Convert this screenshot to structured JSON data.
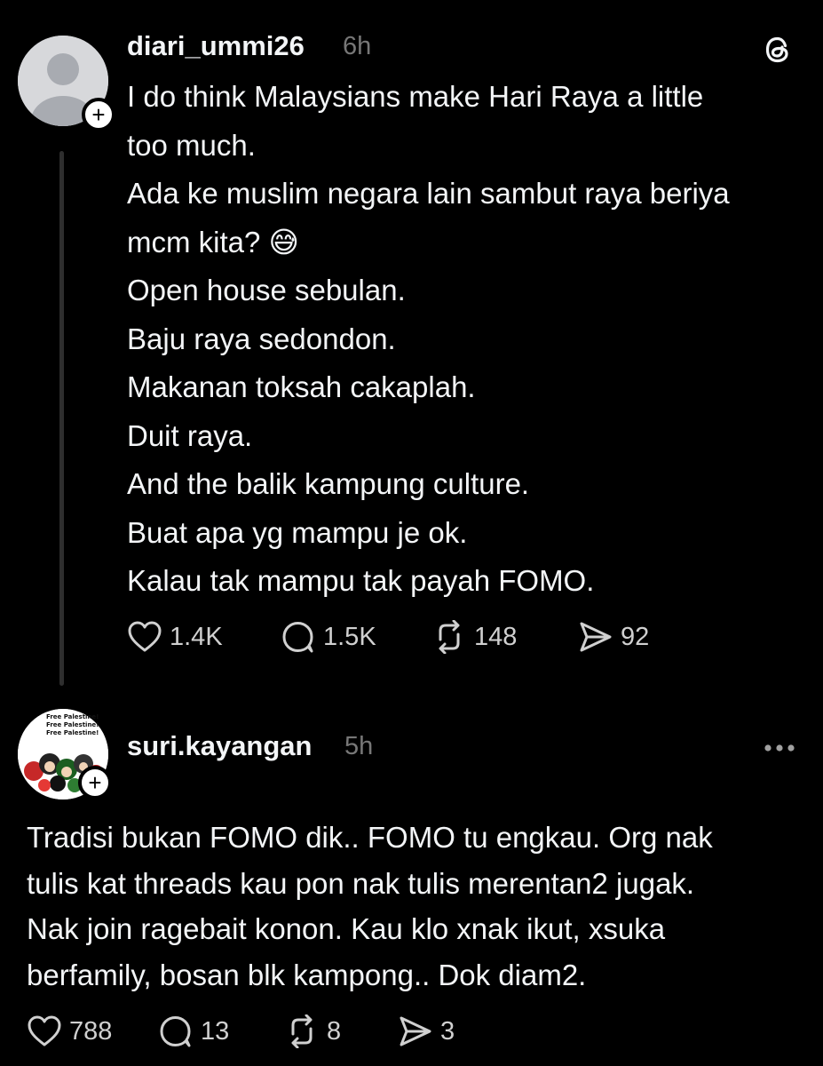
{
  "posts": [
    {
      "username": "diari_ummi26",
      "time": "6h",
      "body_lines": [
        "I do think Malaysians make Hari Raya a little",
        "too much.",
        "Ada ke muslim negara lain sambut raya beriya",
        "mcm kita? 😅",
        "Open house sebulan.",
        "Baju raya sedondon.",
        "Makanan toksah cakaplah.",
        "Duit raya.",
        "And the balik kampung culture.",
        "Buat apa yg mampu je ok.",
        "Kalau tak mampu tak payah FOMO."
      ],
      "likes": "1.4K",
      "replies": "1.5K",
      "reposts": "148",
      "shares": "92",
      "follow_glyph": "+",
      "top_right_icon": "threads-logo-icon"
    },
    {
      "username": "suri.kayangan",
      "time": "5h",
      "avatar_text": [
        "Free Palestine!",
        "Free Palestine!",
        "Free Palestine!"
      ],
      "body_lines": [
        "Tradisi bukan FOMO dik.. FOMO tu engkau.  Org nak",
        "tulis kat threads kau pon nak tulis merentan2 jugak.",
        "Nak join ragebait konon. Kau klo xnak ikut, xsuka",
        "berfamily, bosan blk kampong.. Dok diam2."
      ],
      "likes": "788",
      "replies": "13",
      "reposts": "8",
      "shares": "3",
      "follow_glyph": "+",
      "top_right_icon": "more-options-icon"
    }
  ],
  "colors": {
    "background": "#000000",
    "text": "#f3f5f7",
    "secondary": "#777777",
    "thread_line": "#2e2e2e"
  }
}
